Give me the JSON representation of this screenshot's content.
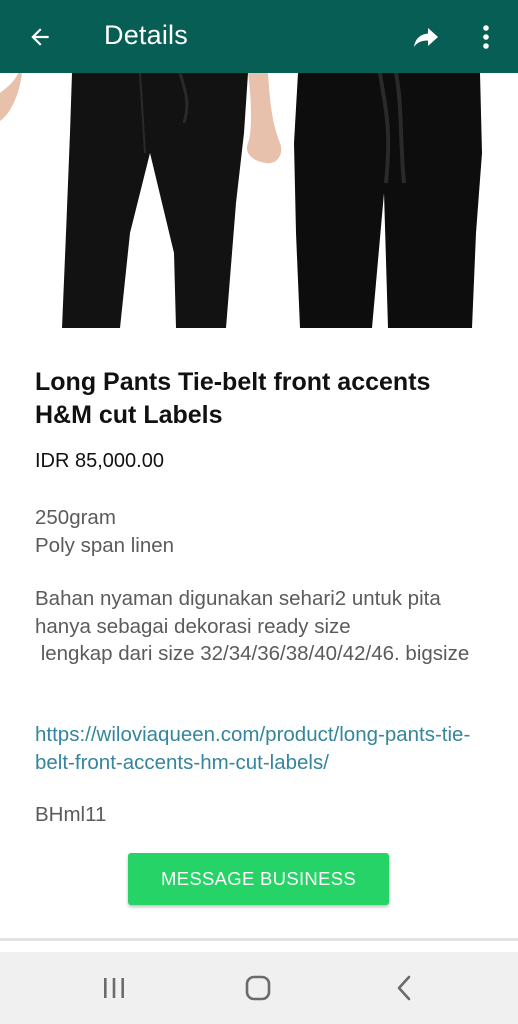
{
  "app_bar": {
    "title": "Details",
    "background": "#075e54"
  },
  "icons": {
    "back": "arrow-left-icon",
    "share": "share-forward-icon",
    "more": "more-vertical-icon"
  },
  "product": {
    "title": "Long Pants Tie-belt front accents H&M cut Labels",
    "price": "IDR 85,000.00",
    "description_1": "250gram\nPoly span linen",
    "description_2": "Bahan nyaman digunakan sehari2 untuk pita hanya sebagai dekorasi ready size\n lengkap dari size 32/34/36/38/40/42/46. bigsize",
    "link": "https://wiloviaqueen.com/product/long-pants-tie-belt-front-accents-hm-cut-labels/",
    "sku": "BHml11"
  },
  "cta": {
    "label": "MESSAGE BUSINESS",
    "color": "#25d366"
  },
  "colors": {
    "link": "#34859d",
    "text_secondary": "#5b5b5b"
  },
  "system_nav": {
    "recents_icon": "recents-icon",
    "home_icon": "home-icon",
    "back_icon": "back-chevron-icon"
  }
}
